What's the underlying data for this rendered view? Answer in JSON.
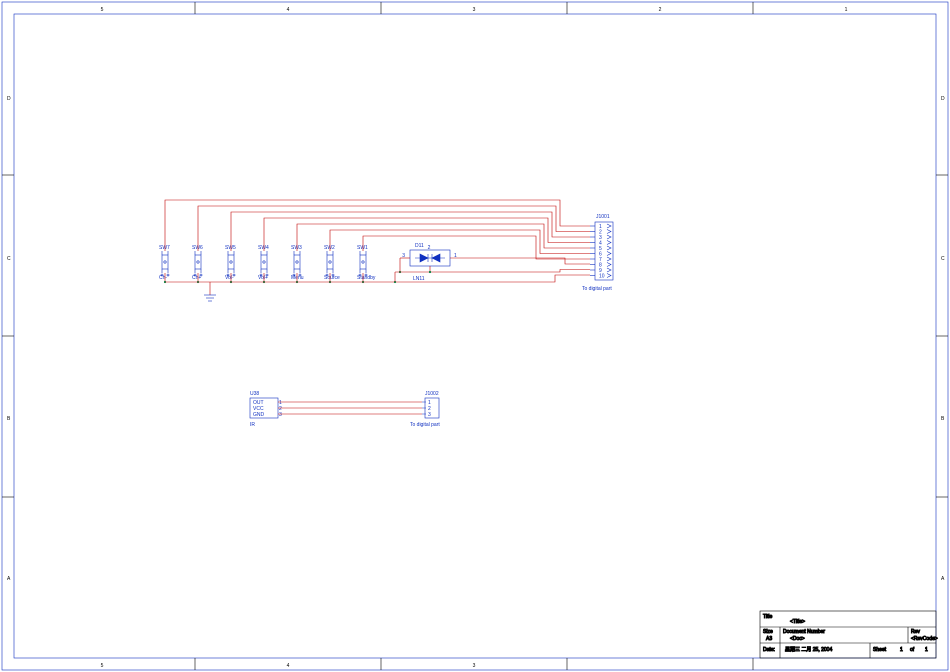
{
  "grid": {
    "cols": [
      "5",
      "4",
      "3",
      "2",
      "1"
    ],
    "rows": [
      "D",
      "C",
      "B",
      "A"
    ]
  },
  "switches": [
    {
      "ref": "SW7",
      "name": "Ch-"
    },
    {
      "ref": "SW6",
      "name": "Ch+"
    },
    {
      "ref": "SW5",
      "name": "Vol-"
    },
    {
      "ref": "SW4",
      "name": "Vol+"
    },
    {
      "ref": "SW3",
      "name": "Menu"
    },
    {
      "ref": "SW2",
      "name": "Source"
    },
    {
      "ref": "SW1",
      "name": "Standby"
    }
  ],
  "conn1": {
    "ref": "J1001",
    "pins": [
      "1",
      "2",
      "3",
      "4",
      "5",
      "6",
      "7",
      "8",
      "9",
      "10"
    ],
    "note": "To digital part"
  },
  "conn2": {
    "ref": "J1002",
    "pins": [
      "1",
      "2",
      "3"
    ],
    "note": "To digital part"
  },
  "ir": {
    "ref": "U38",
    "pins": [
      "OUT",
      "VCC",
      "GND"
    ],
    "name": "IR"
  },
  "led": {
    "ref": "D11",
    "name": "LN11",
    "pins": [
      "1",
      "2",
      "3"
    ]
  },
  "titleblock": {
    "title_label": "Title",
    "title": "<Title>",
    "size_label": "Size",
    "size": "A3",
    "docnum_label": "Document Number",
    "docnum": "<Doc>",
    "rev_label": "Rev",
    "rev": "<RevCode>",
    "date_label": "Date:",
    "date": "星期三 二月 25, 2004",
    "sheet_label": "Sheet",
    "sheet_cur": "1",
    "sheet_of": "of",
    "sheet_tot": "1"
  }
}
